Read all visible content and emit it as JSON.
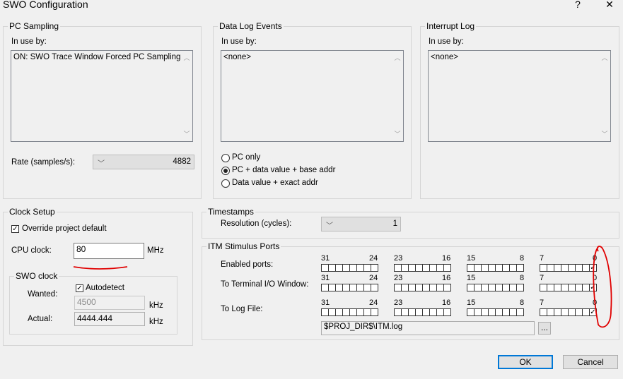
{
  "window": {
    "title": "SWO Configuration",
    "help": "?",
    "close": "✕"
  },
  "pc_sampling": {
    "legend": "PC Sampling",
    "inuse_label": "In use by:",
    "inuse_value": "ON: SWO Trace Window Forced PC Sampling",
    "rate_label": "Rate (samples/s):",
    "rate_value": "4882"
  },
  "data_log": {
    "legend": "Data Log Events",
    "inuse_label": "In use by:",
    "inuse_value": "<none>",
    "options": [
      "PC only",
      "PC + data value + base addr",
      "Data value + exact addr"
    ],
    "selected_index": 1
  },
  "interrupt_log": {
    "legend": "Interrupt Log",
    "inuse_label": "In use by:",
    "inuse_value": "<none>"
  },
  "clock": {
    "legend": "Clock Setup",
    "override_label": "Override project default",
    "override_checked": true,
    "cpu_label": "CPU clock:",
    "cpu_value": "80",
    "cpu_unit": "MHz",
    "swo_legend": "SWO clock",
    "wanted_label": "Wanted:",
    "autodetect_label": "Autodetect",
    "autodetect_checked": true,
    "wanted_value": "4500",
    "wanted_unit": "kHz",
    "actual_label": "Actual:",
    "actual_value": "4444.444",
    "actual_unit": "kHz"
  },
  "timestamps": {
    "legend": "Timestamps",
    "res_label": "Resolution (cycles):",
    "res_value": "1"
  },
  "itm": {
    "legend": "ITM Stimulus Ports",
    "bit_labels": [
      "31",
      "24",
      "23",
      "16",
      "15",
      "8",
      "7",
      "0"
    ],
    "rows": [
      {
        "label": "Enabled ports:",
        "checked_bits": [
          0
        ]
      },
      {
        "label": "To Terminal I/O Window:",
        "checked_bits": [
          0
        ]
      },
      {
        "label": "To Log File:",
        "checked_bits": [
          0
        ]
      }
    ],
    "log_path": "$PROJ_DIR$\\ITM.log",
    "browse": "..."
  },
  "buttons": {
    "ok": "OK",
    "cancel": "Cancel"
  },
  "colors": {
    "annotation": "#e00000",
    "default_button_border": "#0078d7"
  }
}
